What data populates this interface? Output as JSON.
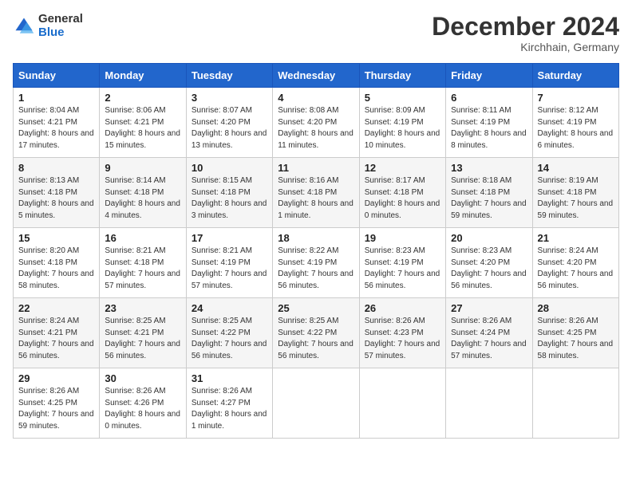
{
  "logo": {
    "general": "General",
    "blue": "Blue"
  },
  "title": "December 2024",
  "location": "Kirchhain, Germany",
  "days_of_week": [
    "Sunday",
    "Monday",
    "Tuesday",
    "Wednesday",
    "Thursday",
    "Friday",
    "Saturday"
  ],
  "weeks": [
    [
      {
        "day": 1,
        "sunrise": "8:04 AM",
        "sunset": "4:21 PM",
        "daylight": "8 hours and 17 minutes."
      },
      {
        "day": 2,
        "sunrise": "8:06 AM",
        "sunset": "4:21 PM",
        "daylight": "8 hours and 15 minutes."
      },
      {
        "day": 3,
        "sunrise": "8:07 AM",
        "sunset": "4:20 PM",
        "daylight": "8 hours and 13 minutes."
      },
      {
        "day": 4,
        "sunrise": "8:08 AM",
        "sunset": "4:20 PM",
        "daylight": "8 hours and 11 minutes."
      },
      {
        "day": 5,
        "sunrise": "8:09 AM",
        "sunset": "4:19 PM",
        "daylight": "8 hours and 10 minutes."
      },
      {
        "day": 6,
        "sunrise": "8:11 AM",
        "sunset": "4:19 PM",
        "daylight": "8 hours and 8 minutes."
      },
      {
        "day": 7,
        "sunrise": "8:12 AM",
        "sunset": "4:19 PM",
        "daylight": "8 hours and 6 minutes."
      }
    ],
    [
      {
        "day": 8,
        "sunrise": "8:13 AM",
        "sunset": "4:18 PM",
        "daylight": "8 hours and 5 minutes."
      },
      {
        "day": 9,
        "sunrise": "8:14 AM",
        "sunset": "4:18 PM",
        "daylight": "8 hours and 4 minutes."
      },
      {
        "day": 10,
        "sunrise": "8:15 AM",
        "sunset": "4:18 PM",
        "daylight": "8 hours and 3 minutes."
      },
      {
        "day": 11,
        "sunrise": "8:16 AM",
        "sunset": "4:18 PM",
        "daylight": "8 hours and 1 minute."
      },
      {
        "day": 12,
        "sunrise": "8:17 AM",
        "sunset": "4:18 PM",
        "daylight": "8 hours and 0 minutes."
      },
      {
        "day": 13,
        "sunrise": "8:18 AM",
        "sunset": "4:18 PM",
        "daylight": "7 hours and 59 minutes."
      },
      {
        "day": 14,
        "sunrise": "8:19 AM",
        "sunset": "4:18 PM",
        "daylight": "7 hours and 59 minutes."
      }
    ],
    [
      {
        "day": 15,
        "sunrise": "8:20 AM",
        "sunset": "4:18 PM",
        "daylight": "7 hours and 58 minutes."
      },
      {
        "day": 16,
        "sunrise": "8:21 AM",
        "sunset": "4:18 PM",
        "daylight": "7 hours and 57 minutes."
      },
      {
        "day": 17,
        "sunrise": "8:21 AM",
        "sunset": "4:19 PM",
        "daylight": "7 hours and 57 minutes."
      },
      {
        "day": 18,
        "sunrise": "8:22 AM",
        "sunset": "4:19 PM",
        "daylight": "7 hours and 56 minutes."
      },
      {
        "day": 19,
        "sunrise": "8:23 AM",
        "sunset": "4:19 PM",
        "daylight": "7 hours and 56 minutes."
      },
      {
        "day": 20,
        "sunrise": "8:23 AM",
        "sunset": "4:20 PM",
        "daylight": "7 hours and 56 minutes."
      },
      {
        "day": 21,
        "sunrise": "8:24 AM",
        "sunset": "4:20 PM",
        "daylight": "7 hours and 56 minutes."
      }
    ],
    [
      {
        "day": 22,
        "sunrise": "8:24 AM",
        "sunset": "4:21 PM",
        "daylight": "7 hours and 56 minutes."
      },
      {
        "day": 23,
        "sunrise": "8:25 AM",
        "sunset": "4:21 PM",
        "daylight": "7 hours and 56 minutes."
      },
      {
        "day": 24,
        "sunrise": "8:25 AM",
        "sunset": "4:22 PM",
        "daylight": "7 hours and 56 minutes."
      },
      {
        "day": 25,
        "sunrise": "8:25 AM",
        "sunset": "4:22 PM",
        "daylight": "7 hours and 56 minutes."
      },
      {
        "day": 26,
        "sunrise": "8:26 AM",
        "sunset": "4:23 PM",
        "daylight": "7 hours and 57 minutes."
      },
      {
        "day": 27,
        "sunrise": "8:26 AM",
        "sunset": "4:24 PM",
        "daylight": "7 hours and 57 minutes."
      },
      {
        "day": 28,
        "sunrise": "8:26 AM",
        "sunset": "4:25 PM",
        "daylight": "7 hours and 58 minutes."
      }
    ],
    [
      {
        "day": 29,
        "sunrise": "8:26 AM",
        "sunset": "4:25 PM",
        "daylight": "7 hours and 59 minutes."
      },
      {
        "day": 30,
        "sunrise": "8:26 AM",
        "sunset": "4:26 PM",
        "daylight": "8 hours and 0 minutes."
      },
      {
        "day": 31,
        "sunrise": "8:26 AM",
        "sunset": "4:27 PM",
        "daylight": "8 hours and 1 minute."
      },
      null,
      null,
      null,
      null
    ]
  ]
}
